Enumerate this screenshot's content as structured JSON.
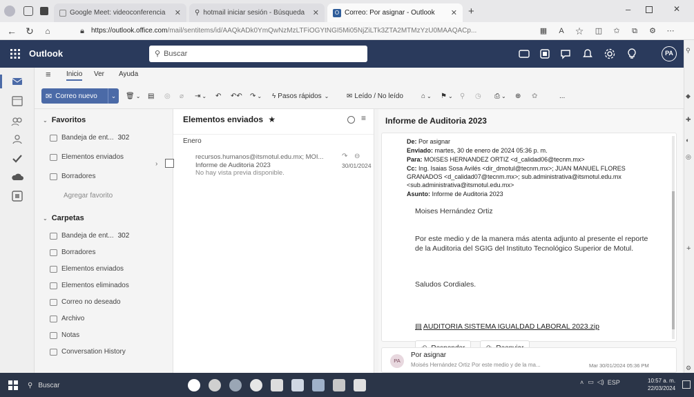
{
  "browser": {
    "tabs": [
      {
        "label": "Google Meet: videoconferencia",
        "icon": "google-meet-icon"
      },
      {
        "label": "hotmail iniciar sesión - Búsqueda",
        "icon": "search-icon"
      },
      {
        "label": "Correo: Por asignar - Outlook",
        "icon": "outlook-icon"
      }
    ],
    "url_host": "https://outlook.office.com",
    "url_path": "/mail/sentitems/id/AAQkADk0YmQwNzMzLTFiOGYtNGI5Mi05NjZiLTk3ZTA2MTMzYzU0MAAQACp..."
  },
  "app": {
    "name": "Outlook",
    "search_placeholder": "Buscar",
    "avatar_initials": "PA"
  },
  "ribbon": {
    "tabs": [
      "Inicio",
      "Ver",
      "Ayuda"
    ],
    "new_mail": "Correo nuevo",
    "quick_steps": "Pasos rápidos",
    "read_unread": "Leído / No leído",
    "more": "..."
  },
  "folders": {
    "favorites_label": "Favoritos",
    "favorites": [
      {
        "label": "Bandeja de ent...",
        "count": "302",
        "icon": "inbox-icon"
      },
      {
        "label": "Elementos enviados",
        "count": "",
        "icon": "sent-icon"
      },
      {
        "label": "Borradores",
        "count": "",
        "icon": "drafts-icon"
      }
    ],
    "add_favorite": "Agregar favorito",
    "folders_label": "Carpetas",
    "folders": [
      {
        "label": "Bandeja de ent...",
        "count": "302",
        "icon": "inbox-icon"
      },
      {
        "label": "Borradores",
        "count": "",
        "icon": "drafts-icon"
      },
      {
        "label": "Elementos enviados",
        "count": "",
        "icon": "sent-icon"
      },
      {
        "label": "Elementos eliminados",
        "count": "",
        "icon": "trash-icon"
      },
      {
        "label": "Correo no deseado",
        "count": "",
        "icon": "junk-icon"
      },
      {
        "label": "Archivo",
        "count": "",
        "icon": "archive-icon"
      },
      {
        "label": "Notas",
        "count": "",
        "icon": "notes-icon"
      },
      {
        "label": "Conversation History",
        "count": "",
        "icon": "folder-icon"
      }
    ]
  },
  "message_list": {
    "title": "Elementos enviados",
    "group": "Enero",
    "item": {
      "from": "recursos.humanos@itsmotul.edu.mx; MOI...",
      "subject": "Informe de Auditoria 2023",
      "preview": "No hay vista previa disponible.",
      "date": "30/01/2024"
    }
  },
  "reading": {
    "subject": "Informe de Auditoria 2023",
    "header": {
      "de_label": "De:",
      "de": "Por asignar",
      "enviado_label": "Enviado:",
      "enviado": "martes, 30 de enero de 2024 05:36 p. m.",
      "para_label": "Para:",
      "para": "MOISES HERNANDEZ ORTIZ <d_calidad06@tecnm.mx>",
      "cc_label": "Cc:",
      "cc": "Ing. Isaias Sosa Avilés <dir_dmotul@tecnm.mx>; JUAN MANUEL FLORES GRANADOS <d_calidad07@tecnm.mx>; sub.administrativa@itsmotul.edu.mx <sub.administrativa@itsmotul.edu.mx>",
      "asunto_label": "Asunto:",
      "asunto": "Informe de Auditoria 2023"
    },
    "greeting": "Moises Hernández Ortiz",
    "body": "Por este medio y de la manera más atenta adjunto al presente el reporte de la Auditoria del SGIG del Instituto Tecnológico Superior de Motul.",
    "closing": "Saludos Cordiales.",
    "attachment": "AUDITORIA SISTEMA IGUALDAD LABORAL 2023.zip",
    "reply": "Responder",
    "forward": "Reenviar",
    "thread": {
      "avatar": "PA",
      "sender": "Por asignar",
      "preview": "Moisés Hernández Ortiz Por este medio y de la ma...",
      "date": "Mar 30/01/2024 05:36 PM"
    }
  },
  "taskbar": {
    "search": "Buscar",
    "lang": "ESP",
    "time": "10:57 a. m.",
    "date": "22/03/2024"
  },
  "colors": {
    "header": "#2a3a5c",
    "accent": "#4b6aa7",
    "taskbar": "#2b3548"
  }
}
